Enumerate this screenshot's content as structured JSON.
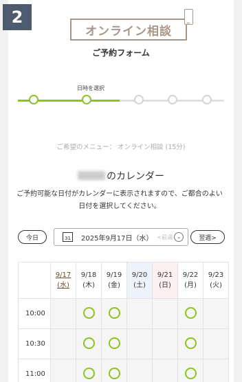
{
  "badge": "2",
  "header": {
    "title": "オンライン相談",
    "subtitle": "ご予約フォーム"
  },
  "steps": {
    "current_label": "日時を選択"
  },
  "menu_line": "ご希望のメニュー： オンライン相談 (15分)",
  "calendar": {
    "title_suffix": "のカレンダー",
    "description": "ご予約可能な日付がカレンダーに表示されますので、ご都合のよい日付を選択してください。",
    "today_button": "今日",
    "date_value": "2025年9月17日（水）",
    "prev_week": "前週",
    "next_week_button": "翌週>",
    "days": [
      {
        "date": "9/17",
        "dow": "(水)"
      },
      {
        "date": "9/18",
        "dow": "(木)"
      },
      {
        "date": "9/19",
        "dow": "(金)"
      },
      {
        "date": "9/20",
        "dow": "(土)"
      },
      {
        "date": "9/21",
        "dow": "(日)"
      },
      {
        "date": "9/22",
        "dow": "(月)"
      },
      {
        "date": "9/23",
        "dow": "(火)"
      }
    ],
    "times": [
      "10:00",
      "10:30",
      "11:00"
    ]
  },
  "colors": {
    "accent": "#8dc21f",
    "brand": "#a8968a",
    "badge": "#4e5a6e"
  }
}
